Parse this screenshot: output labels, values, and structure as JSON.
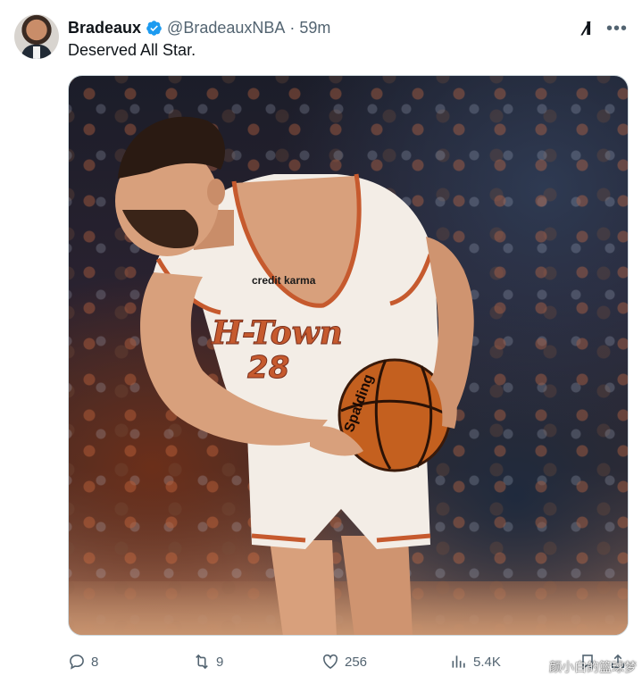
{
  "tweet": {
    "author_name": "Bradeaux",
    "handle": "@BradeauxNBA",
    "separator": "·",
    "time": "59m",
    "text": "Deserved All Star."
  },
  "media": {
    "jersey_sponsor": "credit karma",
    "jersey_wordmark": "H-Town",
    "jersey_number": "28",
    "ball_brand": "Spalding"
  },
  "icons": {
    "verified": "verified-badge-icon",
    "grok": "grok-icon",
    "more": "more-icon",
    "reply": "reply-icon",
    "retweet": "retweet-icon",
    "like": "heart-icon",
    "views": "views-icon",
    "bookmark": "bookmark-icon",
    "share": "share-icon"
  },
  "stats": {
    "replies": "8",
    "retweets": "9",
    "likes": "256",
    "views": "5.4K"
  },
  "watermark": "颜小白的篮球梦",
  "colors": {
    "verified": "#1d9bf0",
    "text": "#0f1419",
    "secondary": "#536471",
    "jersey": "#f3ede6",
    "jersey_trim": "#c65a2e"
  }
}
